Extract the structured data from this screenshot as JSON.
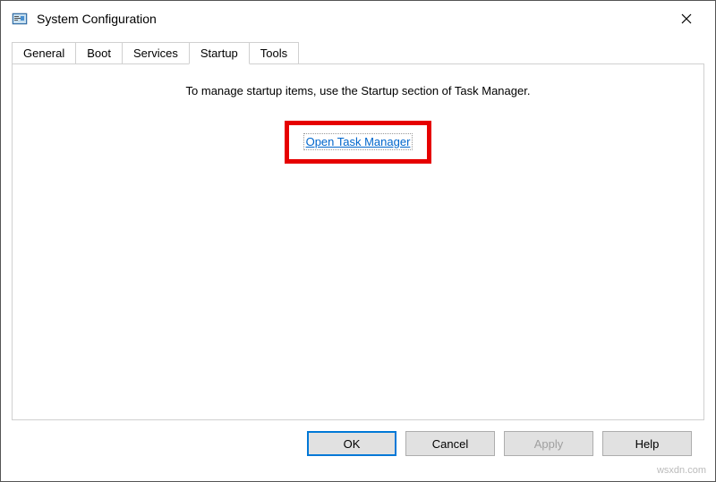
{
  "window": {
    "title": "System Configuration"
  },
  "tabs": {
    "general": "General",
    "boot": "Boot",
    "services": "Services",
    "startup": "Startup",
    "tools": "Tools"
  },
  "content": {
    "instruction": "To manage startup items, use the Startup section of Task Manager.",
    "link": "Open Task Manager"
  },
  "buttons": {
    "ok": "OK",
    "cancel": "Cancel",
    "apply": "Apply",
    "help": "Help"
  },
  "watermark": "wsxdn.com"
}
